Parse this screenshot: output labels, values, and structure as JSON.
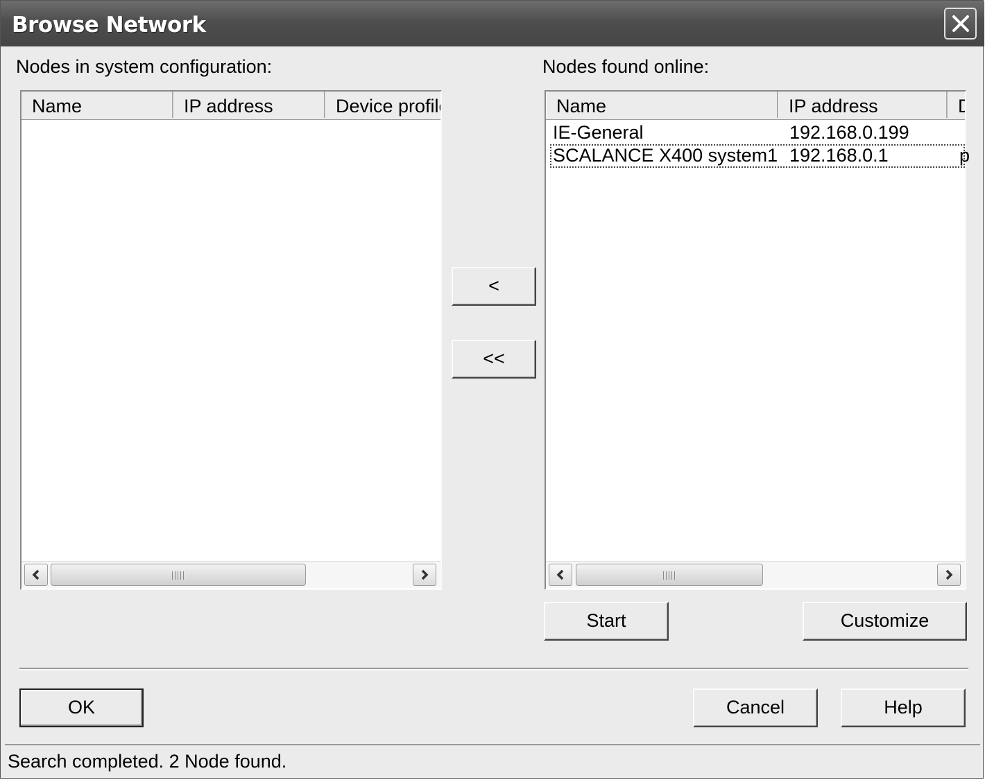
{
  "window": {
    "title": "Browse Network"
  },
  "left": {
    "label": "Nodes in system configuration:",
    "columns": [
      "Name",
      "IP address",
      "Device profile"
    ],
    "rows": []
  },
  "right": {
    "label": "Nodes found online:",
    "columns": [
      "Name",
      "IP address",
      "D"
    ],
    "rows": [
      {
        "name": "IE-General",
        "ip": "192.168.0.199",
        "extra": ""
      },
      {
        "name": "SCALANCE X400 system1",
        "ip": "192.168.0.1",
        "extra": "p"
      }
    ]
  },
  "transfer": {
    "move_one": "<",
    "move_all": "<<"
  },
  "buttons": {
    "start": "Start",
    "customize": "Customize",
    "ok": "OK",
    "cancel": "Cancel",
    "help": "Help"
  },
  "status": "Search completed. 2 Node found.",
  "icons": {
    "close": "close-icon",
    "scroll_left": "chevron-left-icon",
    "scroll_right": "chevron-right-icon",
    "grip": "scroll-grip-icon"
  }
}
